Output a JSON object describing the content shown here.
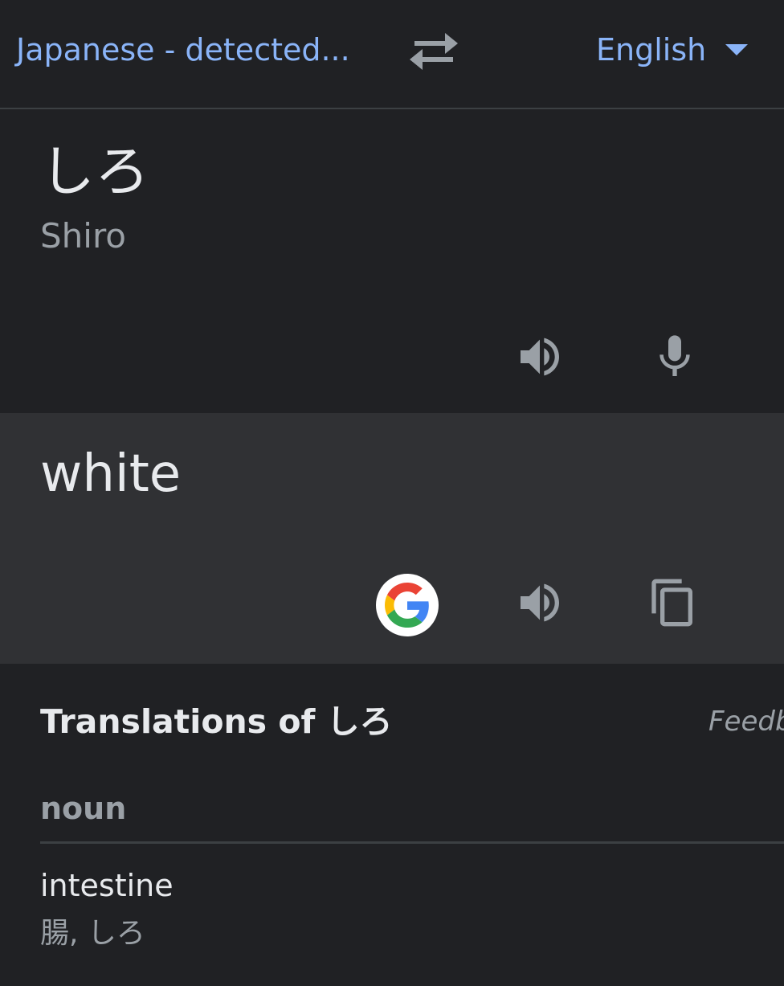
{
  "language_bar": {
    "source_language": "Japanese - detected...",
    "target_language": "English",
    "swap_icon": "swap-arrows-icon",
    "caret_icon": "dropdown-caret-icon",
    "accent_color": "#8ab4f8"
  },
  "source": {
    "text": "しろ",
    "romanization": "Shiro",
    "icons": [
      "speaker-icon",
      "microphone-icon"
    ]
  },
  "translation": {
    "text": "white",
    "icons": [
      "google-g-icon",
      "speaker-icon",
      "copy-icon"
    ]
  },
  "dictionary": {
    "title": "Translations of しろ",
    "feedback_label": "Feedb",
    "part_of_speech": "noun",
    "entries": [
      {
        "word": "intestine",
        "reverse_translations": "腸, しろ"
      }
    ]
  },
  "colors": {
    "background": "#202124",
    "translation_background": "#303134",
    "primary_text": "#e8eaed",
    "secondary_text": "#9aa0a6",
    "icon": "#9aa0a6"
  }
}
